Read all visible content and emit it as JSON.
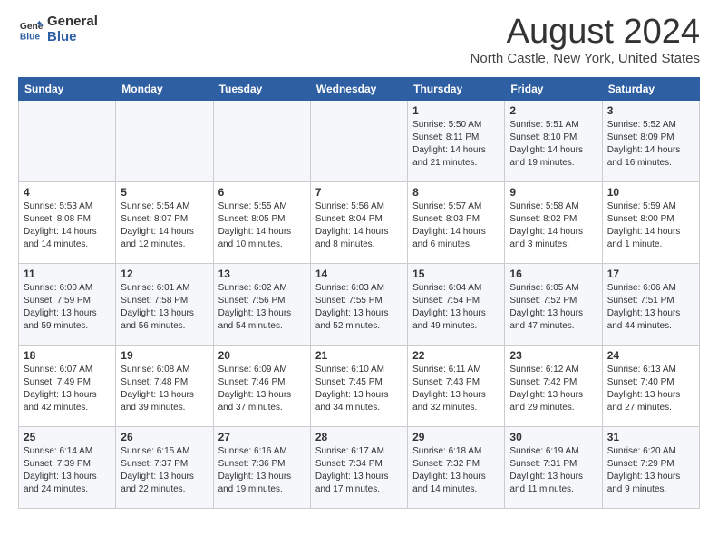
{
  "logo": {
    "line1": "General",
    "line2": "Blue"
  },
  "title": "August 2024",
  "location": "North Castle, New York, United States",
  "days_of_week": [
    "Sunday",
    "Monday",
    "Tuesday",
    "Wednesday",
    "Thursday",
    "Friday",
    "Saturday"
  ],
  "weeks": [
    [
      {
        "day": "",
        "sunrise": "",
        "sunset": "",
        "daylight": ""
      },
      {
        "day": "",
        "sunrise": "",
        "sunset": "",
        "daylight": ""
      },
      {
        "day": "",
        "sunrise": "",
        "sunset": "",
        "daylight": ""
      },
      {
        "day": "",
        "sunrise": "",
        "sunset": "",
        "daylight": ""
      },
      {
        "day": "1",
        "sunrise": "Sunrise: 5:50 AM",
        "sunset": "Sunset: 8:11 PM",
        "daylight": "Daylight: 14 hours and 21 minutes."
      },
      {
        "day": "2",
        "sunrise": "Sunrise: 5:51 AM",
        "sunset": "Sunset: 8:10 PM",
        "daylight": "Daylight: 14 hours and 19 minutes."
      },
      {
        "day": "3",
        "sunrise": "Sunrise: 5:52 AM",
        "sunset": "Sunset: 8:09 PM",
        "daylight": "Daylight: 14 hours and 16 minutes."
      }
    ],
    [
      {
        "day": "4",
        "sunrise": "Sunrise: 5:53 AM",
        "sunset": "Sunset: 8:08 PM",
        "daylight": "Daylight: 14 hours and 14 minutes."
      },
      {
        "day": "5",
        "sunrise": "Sunrise: 5:54 AM",
        "sunset": "Sunset: 8:07 PM",
        "daylight": "Daylight: 14 hours and 12 minutes."
      },
      {
        "day": "6",
        "sunrise": "Sunrise: 5:55 AM",
        "sunset": "Sunset: 8:05 PM",
        "daylight": "Daylight: 14 hours and 10 minutes."
      },
      {
        "day": "7",
        "sunrise": "Sunrise: 5:56 AM",
        "sunset": "Sunset: 8:04 PM",
        "daylight": "Daylight: 14 hours and 8 minutes."
      },
      {
        "day": "8",
        "sunrise": "Sunrise: 5:57 AM",
        "sunset": "Sunset: 8:03 PM",
        "daylight": "Daylight: 14 hours and 6 minutes."
      },
      {
        "day": "9",
        "sunrise": "Sunrise: 5:58 AM",
        "sunset": "Sunset: 8:02 PM",
        "daylight": "Daylight: 14 hours and 3 minutes."
      },
      {
        "day": "10",
        "sunrise": "Sunrise: 5:59 AM",
        "sunset": "Sunset: 8:00 PM",
        "daylight": "Daylight: 14 hours and 1 minute."
      }
    ],
    [
      {
        "day": "11",
        "sunrise": "Sunrise: 6:00 AM",
        "sunset": "Sunset: 7:59 PM",
        "daylight": "Daylight: 13 hours and 59 minutes."
      },
      {
        "day": "12",
        "sunrise": "Sunrise: 6:01 AM",
        "sunset": "Sunset: 7:58 PM",
        "daylight": "Daylight: 13 hours and 56 minutes."
      },
      {
        "day": "13",
        "sunrise": "Sunrise: 6:02 AM",
        "sunset": "Sunset: 7:56 PM",
        "daylight": "Daylight: 13 hours and 54 minutes."
      },
      {
        "day": "14",
        "sunrise": "Sunrise: 6:03 AM",
        "sunset": "Sunset: 7:55 PM",
        "daylight": "Daylight: 13 hours and 52 minutes."
      },
      {
        "day": "15",
        "sunrise": "Sunrise: 6:04 AM",
        "sunset": "Sunset: 7:54 PM",
        "daylight": "Daylight: 13 hours and 49 minutes."
      },
      {
        "day": "16",
        "sunrise": "Sunrise: 6:05 AM",
        "sunset": "Sunset: 7:52 PM",
        "daylight": "Daylight: 13 hours and 47 minutes."
      },
      {
        "day": "17",
        "sunrise": "Sunrise: 6:06 AM",
        "sunset": "Sunset: 7:51 PM",
        "daylight": "Daylight: 13 hours and 44 minutes."
      }
    ],
    [
      {
        "day": "18",
        "sunrise": "Sunrise: 6:07 AM",
        "sunset": "Sunset: 7:49 PM",
        "daylight": "Daylight: 13 hours and 42 minutes."
      },
      {
        "day": "19",
        "sunrise": "Sunrise: 6:08 AM",
        "sunset": "Sunset: 7:48 PM",
        "daylight": "Daylight: 13 hours and 39 minutes."
      },
      {
        "day": "20",
        "sunrise": "Sunrise: 6:09 AM",
        "sunset": "Sunset: 7:46 PM",
        "daylight": "Daylight: 13 hours and 37 minutes."
      },
      {
        "day": "21",
        "sunrise": "Sunrise: 6:10 AM",
        "sunset": "Sunset: 7:45 PM",
        "daylight": "Daylight: 13 hours and 34 minutes."
      },
      {
        "day": "22",
        "sunrise": "Sunrise: 6:11 AM",
        "sunset": "Sunset: 7:43 PM",
        "daylight": "Daylight: 13 hours and 32 minutes."
      },
      {
        "day": "23",
        "sunrise": "Sunrise: 6:12 AM",
        "sunset": "Sunset: 7:42 PM",
        "daylight": "Daylight: 13 hours and 29 minutes."
      },
      {
        "day": "24",
        "sunrise": "Sunrise: 6:13 AM",
        "sunset": "Sunset: 7:40 PM",
        "daylight": "Daylight: 13 hours and 27 minutes."
      }
    ],
    [
      {
        "day": "25",
        "sunrise": "Sunrise: 6:14 AM",
        "sunset": "Sunset: 7:39 PM",
        "daylight": "Daylight: 13 hours and 24 minutes."
      },
      {
        "day": "26",
        "sunrise": "Sunrise: 6:15 AM",
        "sunset": "Sunset: 7:37 PM",
        "daylight": "Daylight: 13 hours and 22 minutes."
      },
      {
        "day": "27",
        "sunrise": "Sunrise: 6:16 AM",
        "sunset": "Sunset: 7:36 PM",
        "daylight": "Daylight: 13 hours and 19 minutes."
      },
      {
        "day": "28",
        "sunrise": "Sunrise: 6:17 AM",
        "sunset": "Sunset: 7:34 PM",
        "daylight": "Daylight: 13 hours and 17 minutes."
      },
      {
        "day": "29",
        "sunrise": "Sunrise: 6:18 AM",
        "sunset": "Sunset: 7:32 PM",
        "daylight": "Daylight: 13 hours and 14 minutes."
      },
      {
        "day": "30",
        "sunrise": "Sunrise: 6:19 AM",
        "sunset": "Sunset: 7:31 PM",
        "daylight": "Daylight: 13 hours and 11 minutes."
      },
      {
        "day": "31",
        "sunrise": "Sunrise: 6:20 AM",
        "sunset": "Sunset: 7:29 PM",
        "daylight": "Daylight: 13 hours and 9 minutes."
      }
    ]
  ]
}
